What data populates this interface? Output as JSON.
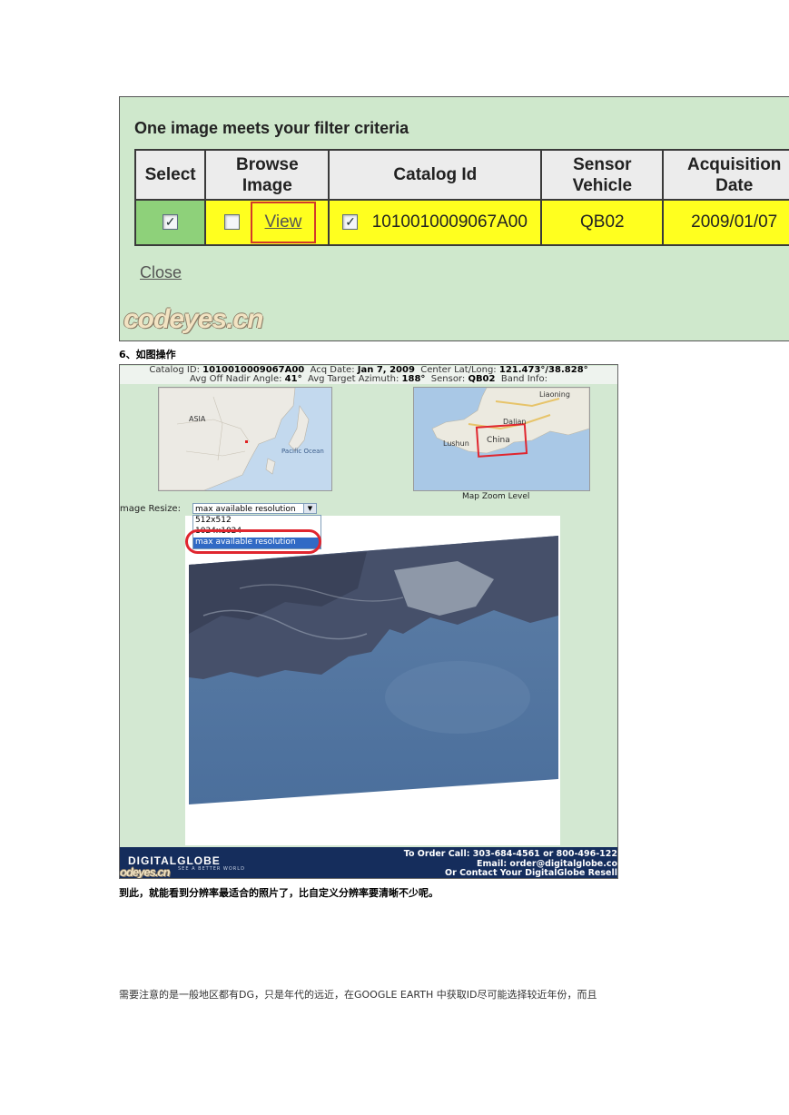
{
  "panel": {
    "heading": "One image meets your filter criteria",
    "columns": [
      "Select",
      "Browse Image",
      "Catalog Id",
      "Sensor Vehicle",
      "Acquisition Date"
    ],
    "row": {
      "view_link": "View",
      "catalog_id": "1010010009067A00",
      "sensor": "QB02",
      "date": "2009/01/07"
    },
    "close_link": "Close",
    "watermark": "codeyes.cn"
  },
  "step_label": "6、如图操作",
  "preview": {
    "catalog_label": "Catalog ID:",
    "catalog_id": "1010010009067A00",
    "acq_label": "Acq Date:",
    "acq_date": "Jan 7, 2009",
    "center_label": "Center Lat/Long:",
    "center": "121.473°/38.828°",
    "off_nadir_label": "Avg Off Nadir Angle:",
    "off_nadir": "41°",
    "azimuth_label": "Avg Target Azimuth:",
    "azimuth": "188°",
    "sensor_label": "Sensor:",
    "sensor": "QB02",
    "band_label": "Band Info:",
    "map_left_labels": [
      "ASIA",
      "Pacific Ocean"
    ],
    "map_right_labels": [
      "Liaoning",
      "Dalian",
      "Lushun",
      "China"
    ],
    "zoom_label": "Map Zoom Level",
    "resize_label": "mage Resize:",
    "resize_value": "max available resolution",
    "resize_options": [
      "512x512",
      "1024x1024",
      "max available resolution"
    ],
    "logo": "DIGITALGLOBE",
    "logo_tag": "SEE A BETTER WORLD",
    "order_lines": [
      "To Order Call: 303-684-4561 or 800-496-122",
      "Email: order@digitalglobe.co",
      "Or Contact Your DigitalGlobe Resell"
    ],
    "watermark": "odeyes.cn"
  },
  "caption": "到此，就能看到分辨率最适合的照片了，比自定义分辨率要清晰不少呢。",
  "note": "需要注意的是一般地区都有DG，只是年代的远近，在GOOGLE EARTH 中获取ID尽可能选择较近年份，而且",
  "colors": {
    "panel_bg": "#cfe8cc",
    "row_yellow": "#ffff1f",
    "select_green": "#8ed17a",
    "highlight_red": "#d33a2a",
    "footer_navy": "#152d5c"
  }
}
